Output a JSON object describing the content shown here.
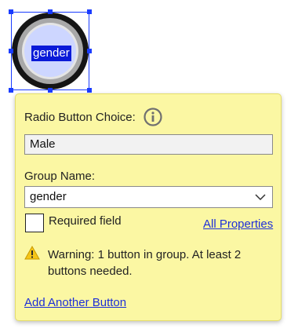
{
  "radio_widget": {
    "label": "gender"
  },
  "popup": {
    "choice_label": "Radio Button Choice:",
    "choice_value": "Male",
    "group_label": "Group Name:",
    "group_value": "gender",
    "required_label": "Required field",
    "required_checked": false,
    "all_properties_link": "All Properties",
    "warning_text": "Warning: 1 button in group. At least 2 buttons needed.",
    "add_button_link": "Add Another Button",
    "icons": {
      "info": "info-icon",
      "dropdown": "chevron-down-icon",
      "warning": "warning-icon"
    }
  },
  "colors": {
    "popup_background": "#fbf7a3",
    "selection_blue": "#1a3cff",
    "label_highlight": "#0a1ad8",
    "link": "#1d2fd8",
    "warning_yellow": "#f5c518"
  }
}
